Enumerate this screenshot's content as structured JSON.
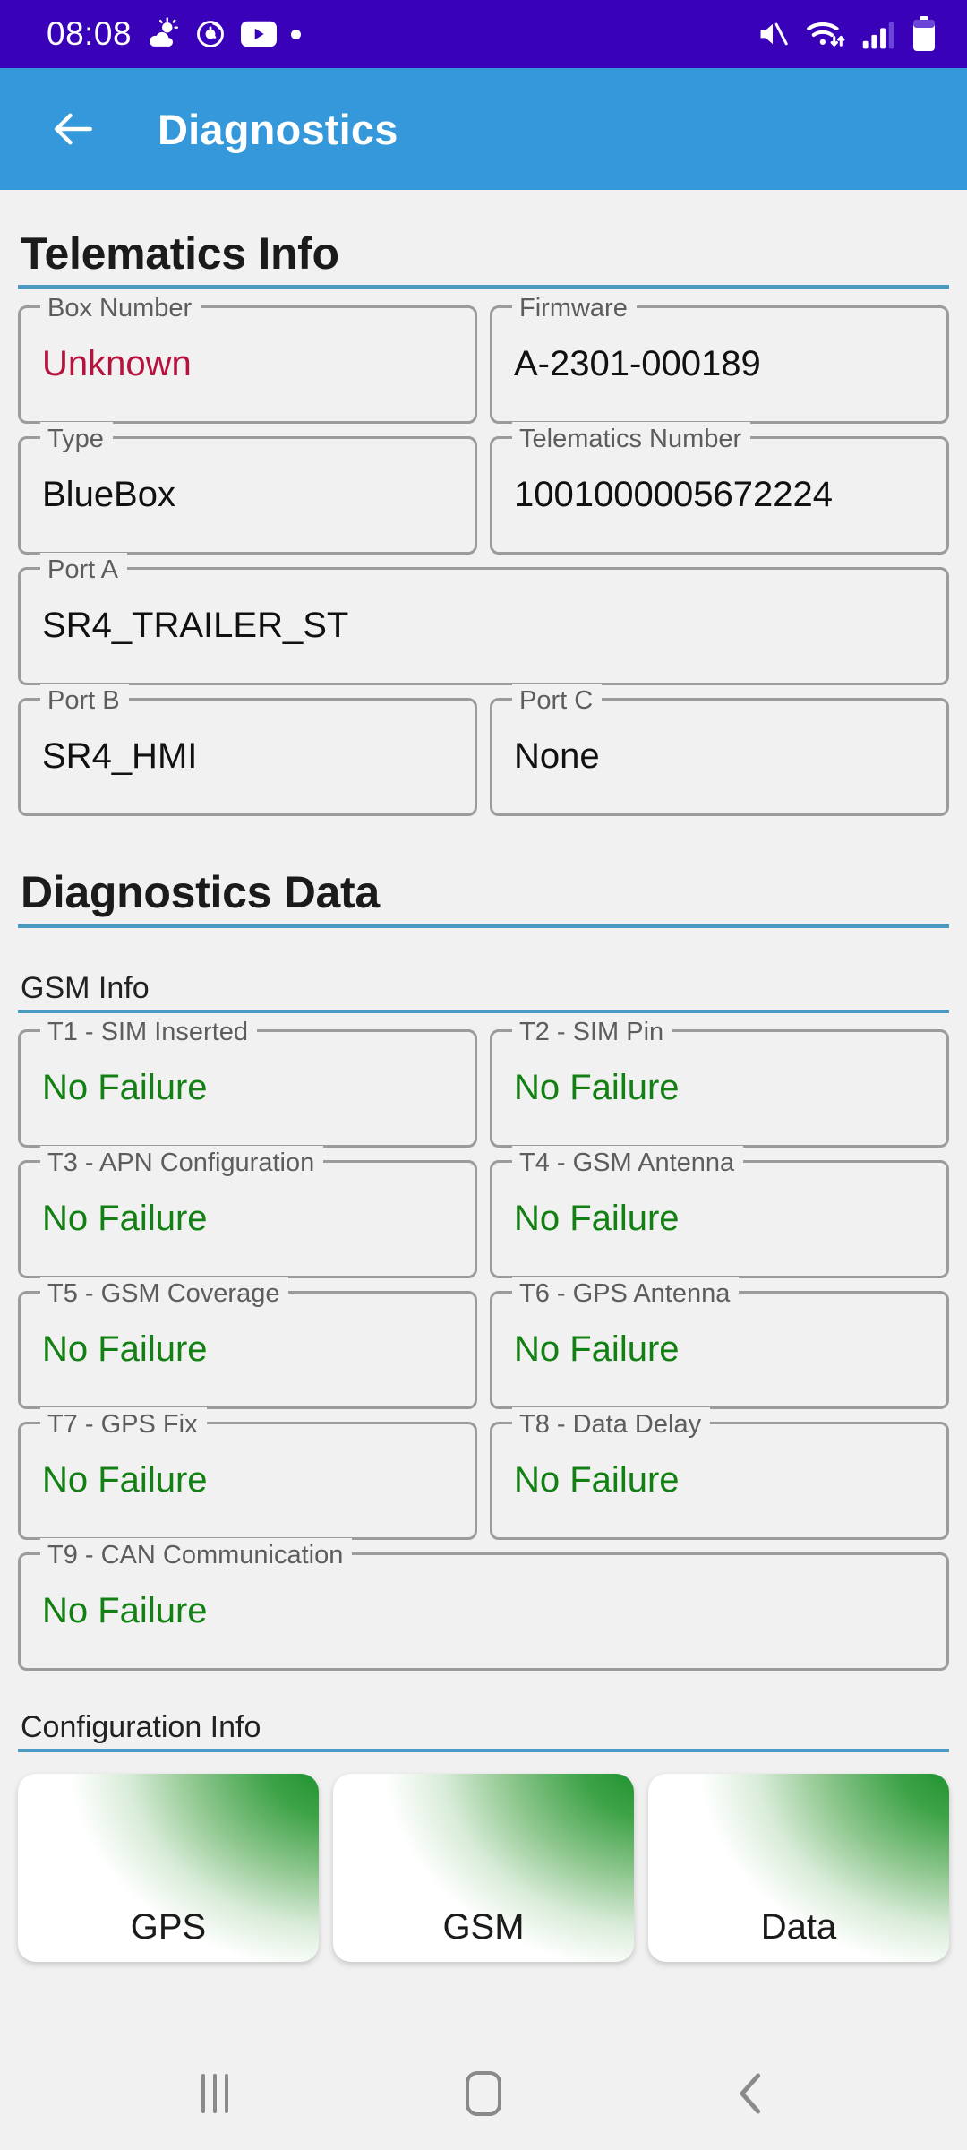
{
  "status_bar": {
    "time": "08:08",
    "left_icons": [
      "weather-partly-cloudy-icon",
      "alarm-icon",
      "youtube-icon",
      "dot-indicator-icon"
    ],
    "right_icons": [
      "mute-icon",
      "wifi-icon",
      "signal-bars-icon",
      "battery-icon"
    ],
    "background_color": "#3a02b8"
  },
  "app_bar": {
    "title": "Diagnostics",
    "back_icon": "arrow-left-icon",
    "background_color": "#3498db"
  },
  "sections": {
    "telematics": {
      "heading": "Telematics Info",
      "fields": [
        {
          "label": "Box Number",
          "value": "Unknown",
          "state": "red"
        },
        {
          "label": "Firmware",
          "value": "A-2301-000189",
          "state": "normal"
        },
        {
          "label": "Type",
          "value": "BlueBox",
          "state": "normal"
        },
        {
          "label": "Telematics Number",
          "value": "1001000005672224",
          "state": "normal"
        },
        {
          "label": "Port A",
          "value": "SR4_TRAILER_ST",
          "state": "normal"
        },
        {
          "label": "Port B",
          "value": "SR4_HMI",
          "state": "normal"
        },
        {
          "label": "Port C",
          "value": "None",
          "state": "normal"
        }
      ]
    },
    "diagnostics": {
      "heading": "Diagnostics Data",
      "gsm": {
        "heading": "GSM Info",
        "tests": [
          {
            "label": "T1 - SIM Inserted",
            "value": "No Failure"
          },
          {
            "label": "T2 - SIM Pin",
            "value": "No Failure"
          },
          {
            "label": "T3 - APN Configuration",
            "value": "No Failure"
          },
          {
            "label": "T4 - GSM Antenna",
            "value": "No Failure"
          },
          {
            "label": "T5 - GSM Coverage",
            "value": "No Failure"
          },
          {
            "label": "T6 - GPS Antenna",
            "value": "No Failure"
          },
          {
            "label": "T7 - GPS Fix",
            "value": "No Failure"
          },
          {
            "label": "T8 - Data Delay",
            "value": "No Failure"
          },
          {
            "label": "T9 - CAN Communication",
            "value": "No Failure"
          }
        ]
      },
      "configuration": {
        "heading": "Configuration Info",
        "cards": [
          {
            "label": "GPS"
          },
          {
            "label": "GSM"
          },
          {
            "label": "Data"
          }
        ]
      }
    }
  },
  "nav_bar": {
    "recents_label": "recents-icon",
    "home_label": "home-icon",
    "back_label": "back-icon"
  },
  "colors": {
    "accent_rule": "#4a9ac4",
    "ok_green": "#128012",
    "error_red": "#b5123e",
    "background": "#f1f1f1"
  }
}
